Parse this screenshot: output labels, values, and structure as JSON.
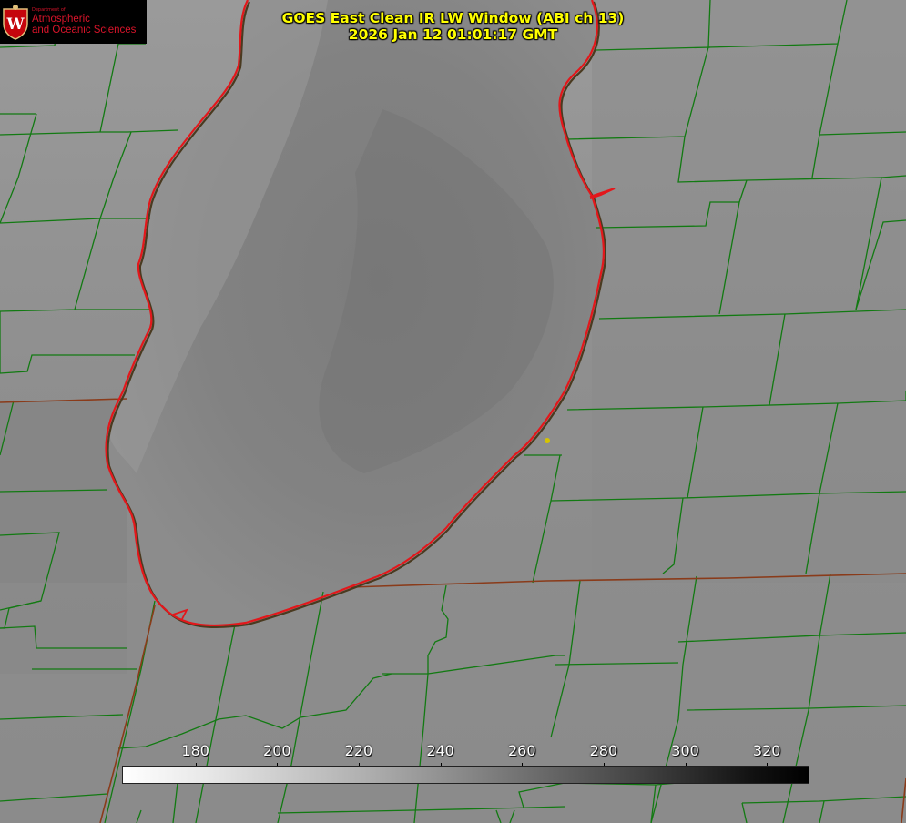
{
  "title": {
    "line1": "GOES East Clean IR LW Window (ABI ch 13)",
    "line2": "2026 Jan 12 01:01:17 GMT"
  },
  "logo": {
    "department": "Department of",
    "name_line1": "Atmospheric",
    "name_line2": "and Oceanic Sciences",
    "crest_letter": "W",
    "accent_color": "#d8142a"
  },
  "colorbar": {
    "ticks": [
      "180",
      "200",
      "220",
      "240",
      "260",
      "280",
      "300",
      "320"
    ],
    "tick_values": [
      180,
      200,
      220,
      240,
      260,
      280,
      300,
      320
    ],
    "range": [
      162,
      330
    ],
    "colormap": "white-to-black grayscale"
  },
  "map": {
    "lake_outline_color": "#e3171b",
    "county_line_color": "#127a12",
    "state_line_color": "#8a3b1a",
    "marker_color": "#d6c400"
  }
}
